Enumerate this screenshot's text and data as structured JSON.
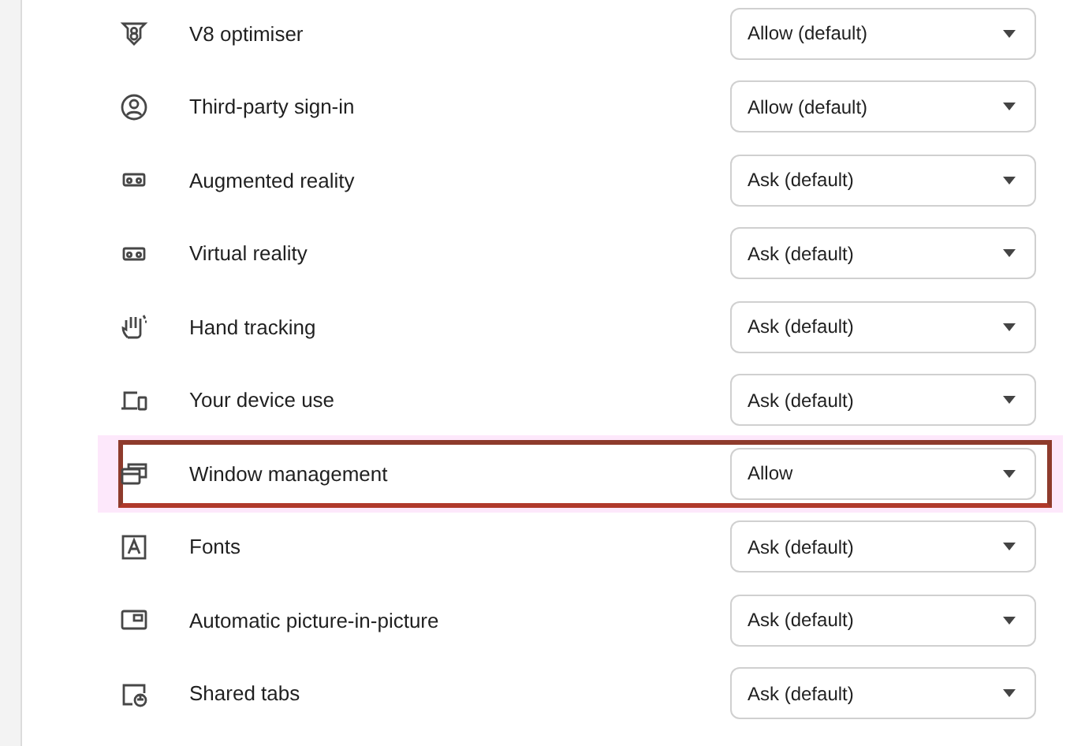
{
  "permissions": [
    {
      "label": "V8 optimiser",
      "kind": "v8",
      "value": "Allow (default)",
      "highlighted": false
    },
    {
      "label": "Third-party sign-in",
      "kind": "account",
      "value": "Allow (default)",
      "highlighted": false
    },
    {
      "label": "Augmented reality",
      "kind": "headset",
      "value": "Ask (default)",
      "highlighted": false
    },
    {
      "label": "Virtual reality",
      "kind": "headset",
      "value": "Ask (default)",
      "highlighted": false
    },
    {
      "label": "Hand tracking",
      "kind": "hand",
      "value": "Ask (default)",
      "highlighted": false
    },
    {
      "label": "Your device use",
      "kind": "devices",
      "value": "Ask (default)",
      "highlighted": false
    },
    {
      "label": "Window management",
      "kind": "windows",
      "value": "Allow",
      "highlighted": true
    },
    {
      "label": "Fonts",
      "kind": "font",
      "value": "Ask (default)",
      "highlighted": false
    },
    {
      "label": "Automatic picture-in-picture",
      "kind": "pip",
      "value": "Ask (default)",
      "highlighted": false
    },
    {
      "label": "Shared tabs",
      "kind": "tab",
      "value": "Ask (default)",
      "highlighted": false
    }
  ]
}
